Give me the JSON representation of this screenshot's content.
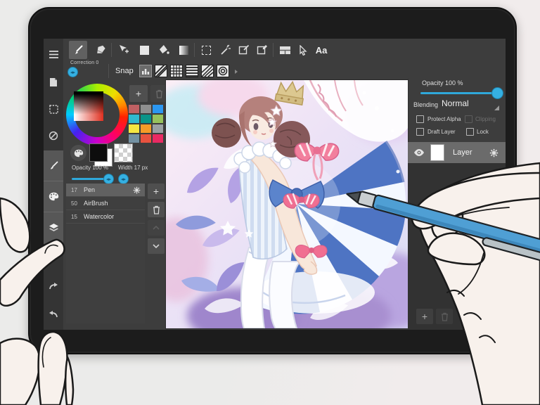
{
  "toolbar": {
    "text_tool_label": "Aa",
    "tools": [
      "pen",
      "eraser",
      "move",
      "shape",
      "fill-bucket",
      "gradient",
      "marquee-select",
      "magic-wand",
      "transform",
      "crop-pen",
      "split-canvas",
      "pointer",
      "text"
    ]
  },
  "options_bar": {
    "correction_label": "Correction 0",
    "snap_label": "Snap",
    "snap_modes": [
      "snap-off",
      "parallel",
      "grid",
      "horizontal",
      "vanishing-point",
      "radial"
    ]
  },
  "sidebar": {
    "icons": [
      "menu",
      "file",
      "select",
      "deselect",
      "brush",
      "palette",
      "layers",
      "redo",
      "undo"
    ]
  },
  "color_panel": {
    "add_button": "+",
    "swatches": [
      "#bf6063",
      "#8f8f8f",
      "#2b97f1",
      "#2fb9cf",
      "#0a9488",
      "#97c25b",
      "#f5e642",
      "#f59b27",
      "#9aa0a3",
      "#7391a2",
      "#e8523f",
      "#ea2a63"
    ],
    "opacity_label": "Opacity 100 %",
    "width_label": "Width 17 px"
  },
  "brush_panel": {
    "add_button": "+",
    "items": [
      {
        "size": "17",
        "name": "Pen",
        "selected": true
      },
      {
        "size": "50",
        "name": "AirBrush",
        "selected": false
      },
      {
        "size": "15",
        "name": "Watercolor",
        "selected": false
      }
    ]
  },
  "layer_panel": {
    "opacity_label": "Opacity 100 %",
    "blending_label": "Blending",
    "blending_value": "Normal",
    "protect_alpha_label": "Protect Alpha",
    "clipping_label": "Clipping",
    "draft_layer_label": "Draft Layer",
    "lock_label": "Lock",
    "add_button": "+",
    "layers": [
      {
        "name": "Layer"
      }
    ]
  },
  "canvas": {
    "description": "Watercolor anime illustration of a girl with pink-brown bun hair, gold crown, white ruffled blue-striped dress, pink bows, white stockings, surrounded by purple and blue leaves and white wing ruffles"
  },
  "colors": {
    "accent_blue": "#2fa8da",
    "screen_bg": "#3d3d3d",
    "tablet_black": "#1b1b1b",
    "stylus_blue": "#4f9fd4"
  }
}
